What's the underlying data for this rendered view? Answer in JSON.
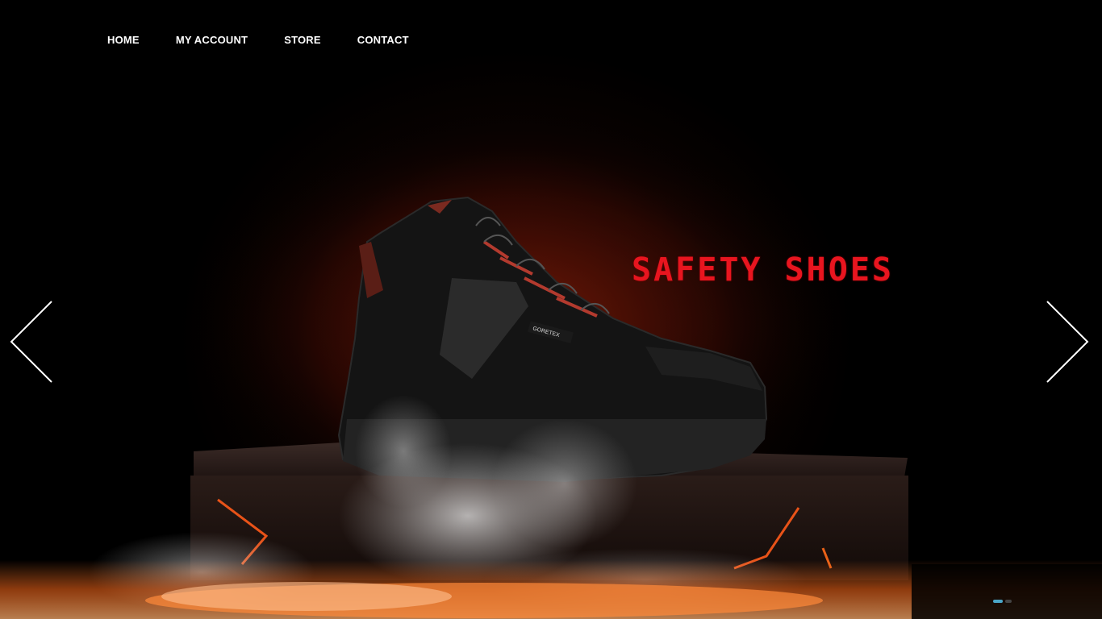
{
  "nav": {
    "items": [
      {
        "label": "HOME"
      },
      {
        "label": "MY ACCOUNT"
      },
      {
        "label": "STORE"
      },
      {
        "label": "CONTACT"
      }
    ]
  },
  "hero": {
    "title": "SAFETY SHOES",
    "title_color": "#e8151f",
    "boot_badge": "GORETEX",
    "prev_icon": "chevron-left-icon",
    "next_icon": "chevron-right-icon"
  },
  "slider": {
    "active_index": 1,
    "indicator_color": "#4aa6c8"
  }
}
